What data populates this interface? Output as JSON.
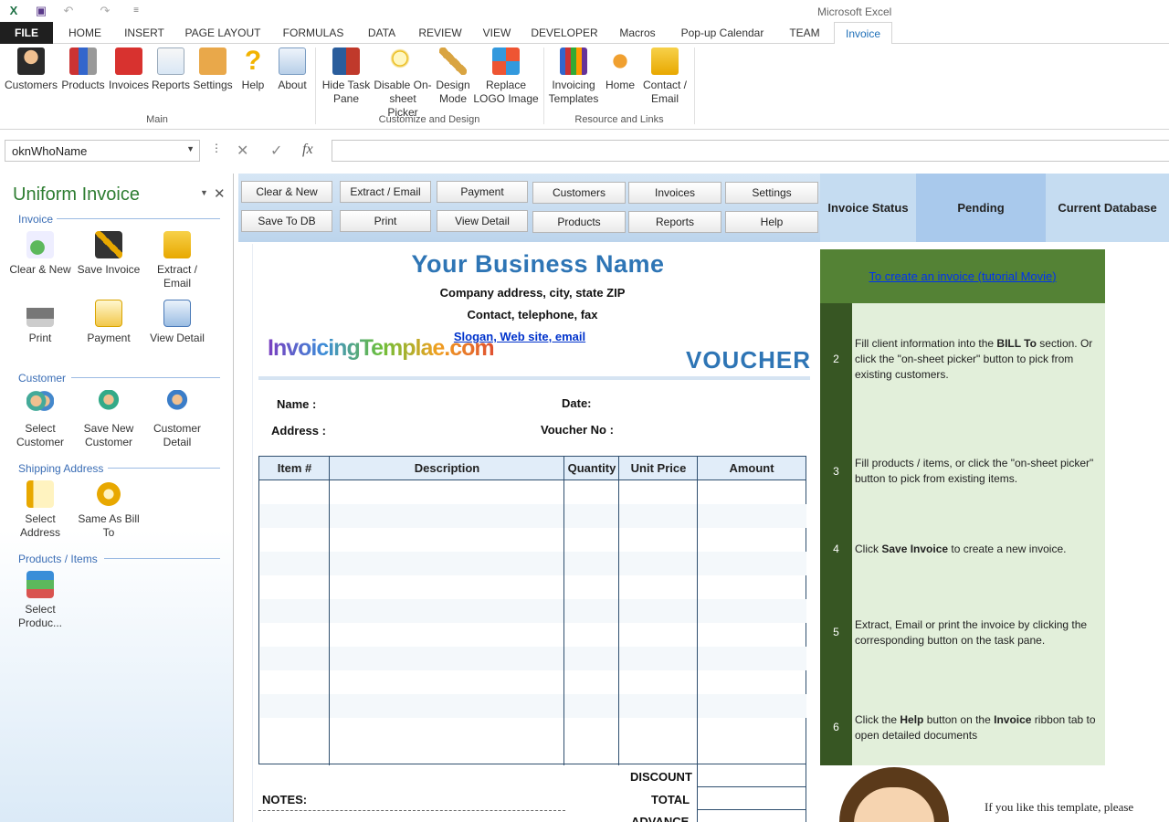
{
  "titlebar": {
    "app_title": "Microsoft Excel"
  },
  "tabs": [
    "FILE",
    "HOME",
    "INSERT",
    "PAGE LAYOUT",
    "FORMULAS",
    "DATA",
    "REVIEW",
    "VIEW",
    "DEVELOPER",
    "Macros",
    "Pop-up Calendar",
    "TEAM",
    "Invoice"
  ],
  "ribbon": {
    "main": {
      "label": "Main",
      "buttons": [
        "Customers",
        "Products",
        "Invoices",
        "Reports",
        "Settings",
        "Help",
        "About"
      ]
    },
    "customize": {
      "label": "Customize and Design",
      "buttons": [
        [
          "Hide Task",
          "Pane"
        ],
        [
          "Disable On-",
          "sheet Picker"
        ],
        [
          "Design",
          "Mode"
        ],
        [
          "Replace",
          "LOGO Image"
        ]
      ]
    },
    "resources": {
      "label": "Resource and Links",
      "buttons": [
        [
          "Invoicing",
          "Templates"
        ],
        [
          "Home",
          ""
        ],
        [
          "Contact /",
          "Email"
        ]
      ]
    }
  },
  "formula_bar": {
    "name_box": "oknWhoName",
    "cancel": "✕",
    "enter": "✓",
    "fx": "fx",
    "value": ""
  },
  "task_pane": {
    "title": "Uniform Invoice",
    "sections": {
      "invoice": {
        "label": "Invoice",
        "buttons": [
          [
            "Clear & New",
            ""
          ],
          [
            "Save Invoice",
            ""
          ],
          [
            "Extract /",
            "Email"
          ],
          [
            "Print",
            ""
          ],
          [
            "Payment",
            ""
          ],
          [
            "View Detail",
            ""
          ]
        ]
      },
      "customer": {
        "label": "Customer",
        "buttons": [
          [
            "Select",
            "Customer"
          ],
          [
            "Save New",
            "Customer"
          ],
          [
            "Customer",
            "Detail"
          ]
        ]
      },
      "shipping": {
        "label": "Shipping Address",
        "buttons": [
          [
            "Select",
            "Address"
          ],
          [
            "Same As Bill",
            "To"
          ]
        ]
      },
      "products": {
        "label": "Products / Items",
        "buttons": [
          [
            "Select",
            "Produc..."
          ]
        ]
      }
    }
  },
  "sheet_toolbar": {
    "row1": [
      "Clear & New",
      "Extract / Email",
      "Payment",
      "Customers",
      "Invoices",
      "Settings"
    ],
    "row2": [
      "Save To DB",
      "Print",
      "View Detail",
      "Products",
      "Reports",
      "Help"
    ]
  },
  "status": {
    "label": "Invoice Status",
    "value": "Pending",
    "db_label": "Current Database"
  },
  "invoice": {
    "business_name": "Your Business Name",
    "address": "Company address, city, state ZIP",
    "contact": "Contact, telephone, fax",
    "slogan": "Slogan, Web site, email",
    "logo_text": "InvoicingTemplae.com",
    "doc_type": "VOUCHER",
    "name_label": "Name :",
    "date_label": "Date:",
    "address_label": "Address :",
    "voucher_no_label": "Voucher No :",
    "columns": [
      "Item #",
      "Description",
      "Quantity",
      "Unit Price",
      "Amount"
    ],
    "discount_label": "DISCOUNT",
    "total_label": "TOTAL",
    "advance_label": "ADVANCE",
    "notes_label": "NOTES:"
  },
  "guide": {
    "link": "To create an invoice (tutorial Movie)",
    "steps": [
      {
        "num": "2",
        "pre": "Fill client information into the ",
        "bold": "BILL To",
        "post": " section. Or click the \"on-sheet picker\" button to pick from existing customers."
      },
      {
        "num": "3",
        "pre": "Fill products / items, or click the \"on-sheet picker\" button to pick from existing items.",
        "bold": "",
        "post": ""
      },
      {
        "num": "4",
        "pre": "Click ",
        "bold": "Save Invoice",
        "post": " to create a new invoice."
      },
      {
        "num": "5",
        "pre": "Extract, Email or print the invoice by clicking the corresponding button on the task pane.",
        "bold": "",
        "post": ""
      },
      {
        "num": "6",
        "pre": "Click the ",
        "bold": "Help",
        "post": " button on the ",
        "bold2": "Invoice",
        "post2": " ribbon tab to open detailed documents"
      }
    ]
  },
  "promo": "If you like this template, please"
}
